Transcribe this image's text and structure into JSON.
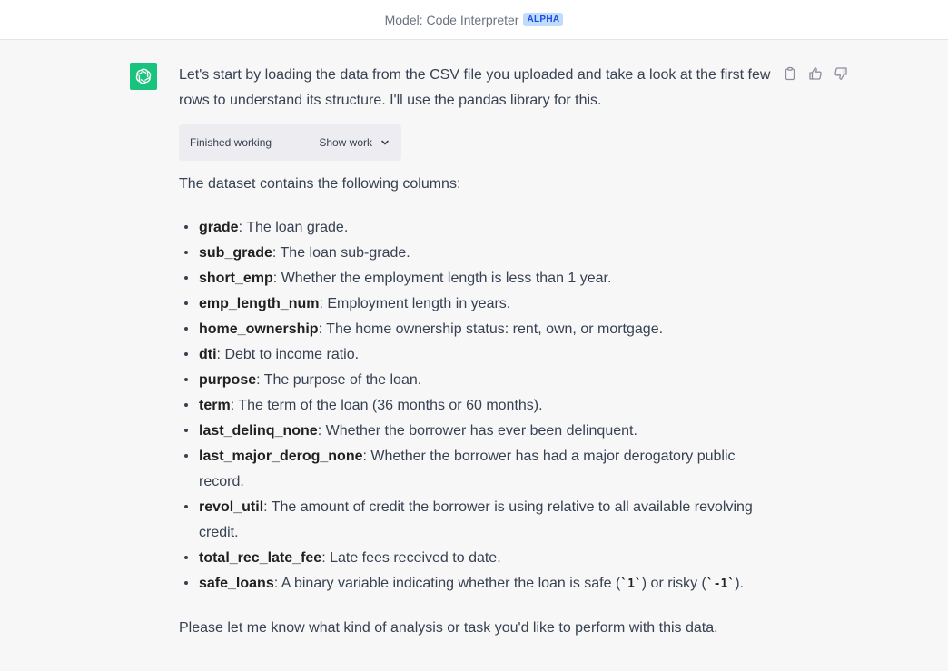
{
  "header": {
    "model_label": "Model: Code Interpreter",
    "badge": "ALPHA"
  },
  "message": {
    "avatar_icon": "openai-logo-icon",
    "avatar_color": "#19c37d",
    "paragraph1": "Let's start by loading the data from the CSV file you uploaded and take a look at the first few rows to understand its structure. I'll use the pandas library for this.",
    "worklog": {
      "status": "Finished working",
      "toggle_label": "Show work"
    },
    "intro": "The dataset contains the following columns:",
    "columns": [
      {
        "name": "grade",
        "desc": ": The loan grade."
      },
      {
        "name": "sub_grade",
        "desc": ": The loan sub-grade."
      },
      {
        "name": "short_emp",
        "desc": ": Whether the employment length is less than 1 year."
      },
      {
        "name": "emp_length_num",
        "desc": ": Employment length in years."
      },
      {
        "name": "home_ownership",
        "desc": ": The home ownership status: rent, own, or mortgage."
      },
      {
        "name": "dti",
        "desc": ": Debt to income ratio."
      },
      {
        "name": "purpose",
        "desc": ": The purpose of the loan."
      },
      {
        "name": "term",
        "desc": ": The term of the loan (36 months or 60 months)."
      },
      {
        "name": "last_delinq_none",
        "desc": ": Whether the borrower has ever been delinquent."
      },
      {
        "name": "last_major_derog_none",
        "desc": ": Whether the borrower has had a major derogatory public record."
      },
      {
        "name": "revol_util",
        "desc": ": The amount of credit the borrower is using relative to all available revolving credit."
      },
      {
        "name": "total_rec_late_fee",
        "desc": ": Late fees received to date."
      }
    ],
    "safe_loans": {
      "name": "safe_loans",
      "pre": ": A binary variable indicating whether the loan is safe (",
      "code1": "`1`",
      "mid": ") or risky (",
      "code2": "`-1`",
      "post": ")."
    },
    "outro": "Please let me know what kind of analysis or task you'd like to perform with this data."
  },
  "actions": [
    "copy-icon",
    "thumbs-up-icon",
    "thumbs-down-icon"
  ]
}
